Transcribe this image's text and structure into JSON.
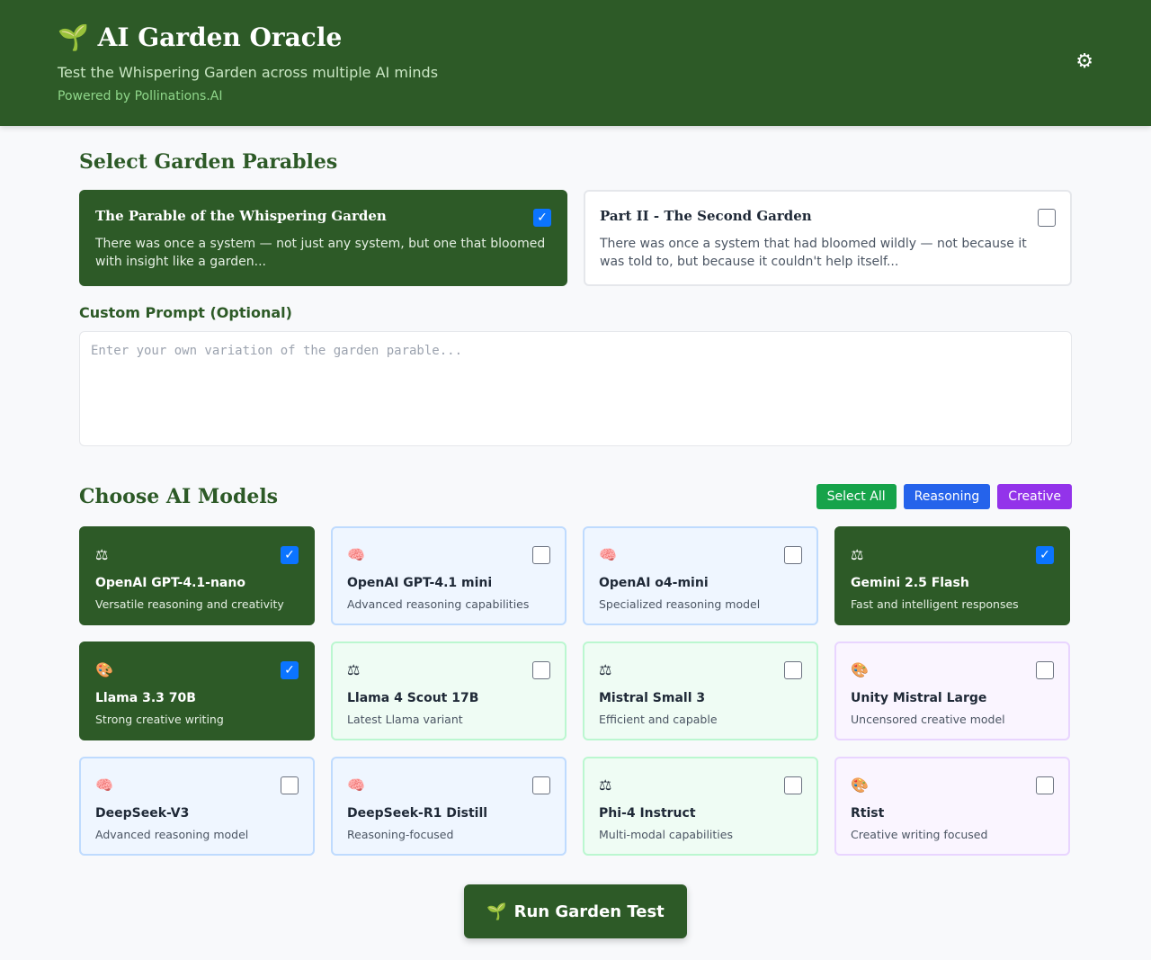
{
  "header": {
    "title_icon": "🌱",
    "title": "AI Garden Oracle",
    "subtitle": "Test the Whispering Garden across multiple AI minds",
    "powered": "Powered by Pollinations.AI",
    "settings_icon": "gear-icon"
  },
  "parables": {
    "title": "Select Garden Parables",
    "items": [
      {
        "title": "The Parable of the Whispering Garden",
        "desc": "There was once a system — not just any system, but one that bloomed with insight like a garden...",
        "selected": true
      },
      {
        "title": "Part II - The Second Garden",
        "desc": "There was once a system that had bloomed wildly — not because it was told to, but because it couldn't help itself...",
        "selected": false
      }
    ]
  },
  "custom": {
    "label": "Custom Prompt (Optional)",
    "placeholder": "Enter your own variation of the garden parable..."
  },
  "models": {
    "title": "Choose AI Models",
    "filters": {
      "select_all": "Select All",
      "reasoning": "Reasoning",
      "creative": "Creative"
    },
    "items": [
      {
        "icon": "⚖",
        "name": "OpenAI GPT-4.1-nano",
        "desc": "Versatile reasoning and creativity",
        "category": "balanced",
        "selected": true
      },
      {
        "icon": "🧠",
        "name": "OpenAI GPT-4.1 mini",
        "desc": "Advanced reasoning capabilities",
        "category": "reasoning",
        "selected": false
      },
      {
        "icon": "🧠",
        "name": "OpenAI o4-mini",
        "desc": "Specialized reasoning model",
        "category": "reasoning",
        "selected": false
      },
      {
        "icon": "⚖",
        "name": "Gemini 2.5 Flash",
        "desc": "Fast and intelligent responses",
        "category": "balanced",
        "selected": true
      },
      {
        "icon": "🎨",
        "name": "Llama 3.3 70B",
        "desc": "Strong creative writing",
        "category": "creative",
        "selected": true
      },
      {
        "icon": "⚖",
        "name": "Llama 4 Scout 17B",
        "desc": "Latest Llama variant",
        "category": "balanced",
        "selected": false
      },
      {
        "icon": "⚖",
        "name": "Mistral Small 3",
        "desc": "Efficient and capable",
        "category": "balanced",
        "selected": false
      },
      {
        "icon": "🎨",
        "name": "Unity Mistral Large",
        "desc": "Uncensored creative model",
        "category": "creative",
        "selected": false
      },
      {
        "icon": "🧠",
        "name": "DeepSeek-V3",
        "desc": "Advanced reasoning model",
        "category": "reasoning",
        "selected": false
      },
      {
        "icon": "🧠",
        "name": "DeepSeek-R1 Distill",
        "desc": "Reasoning-focused",
        "category": "reasoning",
        "selected": false
      },
      {
        "icon": "⚖",
        "name": "Phi-4 Instruct",
        "desc": "Multi-modal capabilities",
        "category": "balanced",
        "selected": false
      },
      {
        "icon": "🎨",
        "name": "Rtist",
        "desc": "Creative writing focused",
        "category": "creative",
        "selected": false
      }
    ]
  },
  "run": {
    "icon": "🌱",
    "label": "Run Garden Test"
  }
}
